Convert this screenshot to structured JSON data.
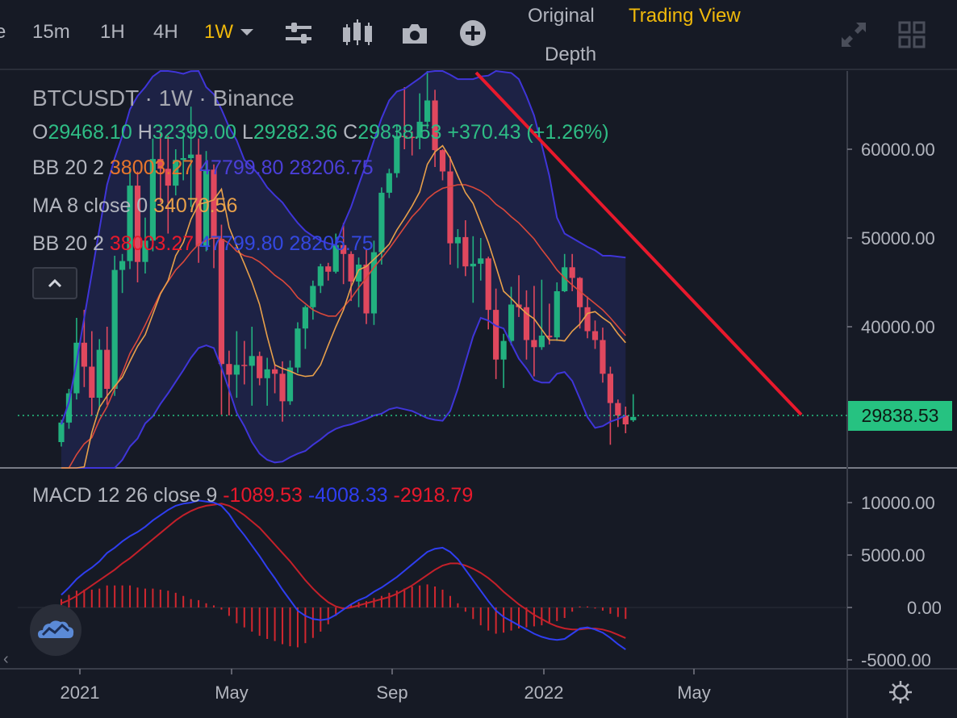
{
  "toolbar": {
    "partial_label": "e",
    "intervals": [
      "15m",
      "1H",
      "4H",
      "1W"
    ],
    "active_interval": "1W",
    "icons": [
      "indicator-settings-icon",
      "candle-type-icon",
      "camera-icon",
      "add-icon",
      "expand-icon",
      "grid-layout-icon"
    ]
  },
  "views": {
    "original": "Original",
    "trading_view": "Trading View",
    "depth": "Depth"
  },
  "legend": {
    "symbol": "BTCUSDT · 1W · Binance",
    "ohlc": {
      "o_label": "O",
      "o": "29468.10",
      "h_label": "H",
      "h": "32399.00",
      "l_label": "L",
      "l": "29282.36",
      "c_label": "C",
      "c": "29838.53",
      "change": "+370.43 (+1.26%)"
    },
    "bb1": {
      "name": "BB 20 2",
      "basis": "38003.27",
      "upper": "47799.80",
      "lower": "28206.75"
    },
    "ma": {
      "name": "MA 8 close 0",
      "value": "34070.56"
    },
    "bb2": {
      "name": "BB 20 2",
      "basis": "38003.27",
      "upper": "47799.80",
      "lower": "28206.75"
    },
    "macd": {
      "name": "MACD 12 26 close 9",
      "hist": "-1089.53",
      "macd": "-4008.33",
      "signal": "-2918.79"
    }
  },
  "last_price": "29838.53",
  "colors": {
    "up": "#26a69a",
    "up_bright": "#2ebd85",
    "down": "#e0485e",
    "accent": "#f0b90b",
    "bb_band": "#4b3fd8",
    "ma": "#e8a04a",
    "bb_basis": "#d9483b",
    "trendline": "#e8192c",
    "badge": "#26c281"
  },
  "chart_data": [
    {
      "type": "candlestick",
      "title": "BTCUSDT · 1W · Binance",
      "yaxis_ticks": [
        "60000.00",
        "50000.00",
        "40000.00"
      ],
      "xaxis_ticks": [
        "2021",
        "May",
        "Sep",
        "2022",
        "May"
      ],
      "ylim": [
        25000,
        70000
      ],
      "candles": [
        [
          27000,
          29500,
          26500,
          29200
        ],
        [
          29200,
          33000,
          28500,
          32500
        ],
        [
          32500,
          41000,
          31800,
          38200
        ],
        [
          38200,
          41900,
          33200,
          35500
        ],
        [
          35500,
          39500,
          30000,
          32000
        ],
        [
          32000,
          38600,
          30600,
          37400
        ],
        [
          37400,
          40000,
          31200,
          33000
        ],
        [
          33000,
          48000,
          32200,
          46400
        ],
        [
          46400,
          48200,
          43800,
          47400
        ],
        [
          47400,
          58000,
          46500,
          55900
        ],
        [
          55900,
          57500,
          45000,
          47300
        ],
        [
          47300,
          52300,
          46000,
          49700
        ],
        [
          49700,
          61200,
          48500,
          58900
        ],
        [
          58900,
          61800,
          54000,
          57800
        ],
        [
          57800,
          61500,
          50500,
          55900
        ],
        [
          55900,
          60000,
          54800,
          58800
        ],
        [
          58800,
          61500,
          56500,
          59000
        ],
        [
          59000,
          64800,
          53500,
          59400
        ],
        [
          59400,
          61200,
          47200,
          49100
        ],
        [
          49100,
          59800,
          48500,
          57700
        ],
        [
          57700,
          58300,
          46600,
          49900
        ],
        [
          49900,
          51500,
          30100,
          35800
        ],
        [
          35800,
          37300,
          30000,
          34600
        ],
        [
          34600,
          39500,
          32000,
          35700
        ],
        [
          35700,
          38400,
          33500,
          35600
        ],
        [
          35600,
          40000,
          31100,
          36700
        ],
        [
          36700,
          37200,
          33400,
          34200
        ],
        [
          34200,
          36500,
          31100,
          35200
        ],
        [
          35200,
          35800,
          32500,
          34700
        ],
        [
          34700,
          36100,
          29300,
          31600
        ],
        [
          31600,
          36200,
          31200,
          35400
        ],
        [
          35400,
          40500,
          34800,
          39800
        ],
        [
          39800,
          42400,
          37500,
          42200
        ],
        [
          42200,
          45200,
          40800,
          44600
        ],
        [
          44600,
          47100,
          43800,
          46800
        ],
        [
          46800,
          47200,
          45200,
          46200
        ],
        [
          46200,
          50500,
          46000,
          49200
        ],
        [
          49200,
          51700,
          44800,
          48200
        ],
        [
          48200,
          48500,
          42900,
          45100
        ],
        [
          45100,
          47800,
          42200,
          47000
        ],
        [
          47000,
          48800,
          40300,
          41500
        ],
        [
          41500,
          49700,
          40200,
          48400
        ],
        [
          48400,
          55700,
          47000,
          55100
        ],
        [
          55100,
          57800,
          54500,
          57300
        ],
        [
          57300,
          62800,
          56800,
          61500
        ],
        [
          61500,
          67000,
          60000,
          61400
        ],
        [
          61400,
          62000,
          59300,
          61300
        ],
        [
          61300,
          66300,
          60000,
          63100
        ],
        [
          63100,
          69000,
          62300,
          65500
        ],
        [
          65500,
          66700,
          58000,
          59900
        ],
        [
          59900,
          60000,
          56500,
          57500
        ],
        [
          57500,
          59200,
          47000,
          49400
        ],
        [
          49400,
          51000,
          46600,
          50100
        ],
        [
          50100,
          52000,
          45700,
          46800
        ],
        [
          46800,
          50200,
          42700,
          47100
        ],
        [
          47100,
          50000,
          45200,
          47700
        ],
        [
          47700,
          47900,
          39700,
          41900
        ],
        [
          41900,
          44300,
          34100,
          36300
        ],
        [
          36300,
          39200,
          33100,
          38400
        ],
        [
          38400,
          44500,
          37900,
          42500
        ],
        [
          42500,
          45800,
          41100,
          42200
        ],
        [
          42200,
          44100,
          36300,
          38500
        ],
        [
          38500,
          44600,
          34400,
          37700
        ],
        [
          37700,
          45300,
          37400,
          39000
        ],
        [
          39000,
          42600,
          38000,
          38800
        ],
        [
          38800,
          45000,
          38400,
          44000
        ],
        [
          44000,
          48200,
          43900,
          46700
        ],
        [
          46700,
          48200,
          44000,
          45500
        ],
        [
          45500,
          45600,
          39800,
          42200
        ],
        [
          42200,
          43400,
          38700,
          39500
        ],
        [
          39500,
          40700,
          37500,
          38500
        ],
        [
          38500,
          39900,
          33700,
          34700
        ],
        [
          34700,
          35500,
          26700,
          31400
        ],
        [
          31400,
          31800,
          28700,
          30000
        ],
        [
          30000,
          31000,
          28000,
          29000
        ],
        [
          29468,
          32399,
          29282,
          29838
        ]
      ],
      "bb_upper": [
        29000,
        31500,
        36000,
        41000,
        46000,
        51000,
        56000,
        59000,
        61500,
        64500,
        66000,
        67000,
        68200,
        69200,
        69600,
        68700,
        68500,
        68800,
        69300,
        67000,
        66200,
        64500,
        62500,
        61000,
        58800,
        58000,
        57000,
        55700,
        54800,
        54000,
        52800,
        51700,
        50800,
        50200,
        49700,
        49400,
        49200,
        51500,
        53500,
        56000,
        58400,
        61000,
        63500,
        65500,
        66500,
        66800,
        67400,
        68000,
        68700,
        69300,
        69200,
        68400,
        67900,
        67900,
        67900,
        68200,
        68300,
        68900,
        68700,
        68600,
        67900,
        66000,
        63800,
        60500,
        57000,
        52300,
        50500,
        50000,
        49500,
        49000,
        48600,
        48000,
        48000,
        47900,
        47800
      ],
      "bb_basis": [
        23500,
        24000,
        25600,
        26800,
        27500,
        29500,
        31000,
        33000,
        34800,
        37000,
        38500,
        40200,
        42000,
        43800,
        45100,
        46400,
        47300,
        48400,
        49300,
        49700,
        50100,
        49900,
        49400,
        48500,
        48000,
        47800,
        47300,
        46600,
        45800,
        45200,
        44400,
        43300,
        42600,
        41900,
        41500,
        41200,
        41200,
        42200,
        43200,
        44400,
        45500,
        46700,
        47700,
        48800,
        50000,
        51200,
        52400,
        53300,
        54400,
        55100,
        55600,
        55800,
        56000,
        56000,
        55700,
        55300,
        54700,
        53800,
        53200,
        52400,
        51700,
        50800,
        49900,
        48700,
        47600,
        46400,
        45500,
        44700,
        44000,
        43300,
        42600,
        41900,
        41000,
        40000,
        39000
      ],
      "bb_lower": [
        17700,
        17100,
        16700,
        17000,
        17000,
        18000,
        20000,
        23000,
        25000,
        26500,
        27400,
        29100,
        29900,
        31300,
        32500,
        33800,
        35100,
        36500,
        37600,
        37900,
        37600,
        35400,
        32900,
        30300,
        28800,
        27000,
        25700,
        25000,
        24700,
        24800,
        25300,
        25700,
        26000,
        26700,
        27300,
        28000,
        28500,
        28800,
        29000,
        29300,
        29600,
        30000,
        30200,
        30700,
        30900,
        30700,
        30500,
        30100,
        29700,
        29500,
        29400,
        30500,
        33000,
        36000,
        38900,
        41000,
        40700,
        40100,
        39800,
        38100,
        36400,
        35300,
        34000,
        33700,
        33700,
        34700,
        34900,
        33900,
        31900,
        29800,
        28600,
        28800,
        29300,
        29600,
        30000
      ],
      "ma8": [
        17700,
        19000,
        21200,
        24200,
        28100,
        30900,
        32200,
        33300,
        34300,
        36100,
        37800,
        39100,
        41400,
        43700,
        45200,
        48000,
        49500,
        52100,
        53800,
        54000,
        54300,
        55500,
        51200,
        49100,
        47100,
        45000,
        42500,
        38900,
        35700,
        35300,
        35000,
        34600,
        34400,
        34500,
        35700,
        37900,
        40000,
        41900,
        44500,
        46400,
        46800,
        47600,
        48400,
        49300,
        50900,
        52200,
        53600,
        55200,
        58300,
        59700,
        60400,
        59000,
        57000,
        55100,
        53900,
        51700,
        49500,
        46800,
        44000,
        43200,
        42300,
        41500,
        40900,
        39700,
        38500,
        38500,
        38400,
        39500,
        40300,
        41500,
        41700,
        41000,
        40400,
        39200,
        38200
      ],
      "macd_line": [
        1200,
        1900,
        2700,
        3300,
        3800,
        4400,
        5200,
        5700,
        6300,
        6800,
        7200,
        7700,
        8300,
        8800,
        9300,
        9700,
        9900,
        10000,
        10200,
        10100,
        10000,
        9700,
        8900,
        7800,
        6900,
        5900,
        4900,
        3800,
        2800,
        1700,
        700,
        -300,
        -800,
        -1100,
        -1200,
        -1100,
        -700,
        -200,
        300,
        700,
        1000,
        1500,
        1900,
        2400,
        2900,
        3500,
        4100,
        4700,
        5300,
        5600,
        5700,
        5300,
        4600,
        3600,
        2600,
        1600,
        600,
        -300,
        -900,
        -1300,
        -1700,
        -2100,
        -2500,
        -2800,
        -3000,
        -3100,
        -3000,
        -2500,
        -2000,
        -1900,
        -2100,
        -2400,
        -2900,
        -3500,
        -4008
      ],
      "signal_line": [
        400,
        700,
        1100,
        1600,
        2100,
        2600,
        3100,
        3600,
        4200,
        4700,
        5300,
        5900,
        6500,
        7100,
        7700,
        8300,
        8800,
        9200,
        9500,
        9700,
        9800,
        9900,
        9700,
        9300,
        8800,
        8200,
        7600,
        6800,
        6000,
        5200,
        4400,
        3500,
        2600,
        1800,
        1100,
        500,
        100,
        -100,
        0,
        200,
        400,
        600,
        800,
        1000,
        1300,
        1700,
        2100,
        2600,
        3100,
        3600,
        4000,
        4200,
        4200,
        4000,
        3700,
        3300,
        2800,
        2200,
        1500,
        900,
        300,
        -200,
        -700,
        -1100,
        -1500,
        -1800,
        -2000,
        -2100,
        -2100,
        -2000,
        -2000,
        -2100,
        -2300,
        -2600,
        -2919
      ],
      "histogram": [
        800,
        1200,
        1600,
        1700,
        1700,
        1800,
        2100,
        2100,
        2100,
        2100,
        1900,
        1800,
        1800,
        1700,
        1600,
        1400,
        1100,
        800,
        700,
        400,
        200,
        -200,
        -800,
        -1500,
        -1900,
        -2300,
        -2700,
        -3000,
        -3200,
        -3500,
        -3700,
        -3800,
        -3400,
        -2900,
        -2300,
        -1600,
        -800,
        -100,
        300,
        500,
        600,
        900,
        1100,
        1400,
        1600,
        1800,
        2000,
        2100,
        2200,
        2000,
        1700,
        1100,
        400,
        -400,
        -1100,
        -1700,
        -2200,
        -2500,
        -2400,
        -2200,
        -2000,
        -1900,
        -1800,
        -1700,
        -1500,
        -1300,
        -1000,
        -400,
        100,
        100,
        -100,
        -300,
        -600,
        -900,
        -1090
      ],
      "macd_ylim": [
        -5500,
        12000
      ],
      "macd_ticks": [
        "10000.00",
        "5000.00",
        "0.00",
        "-5000.00"
      ]
    }
  ]
}
